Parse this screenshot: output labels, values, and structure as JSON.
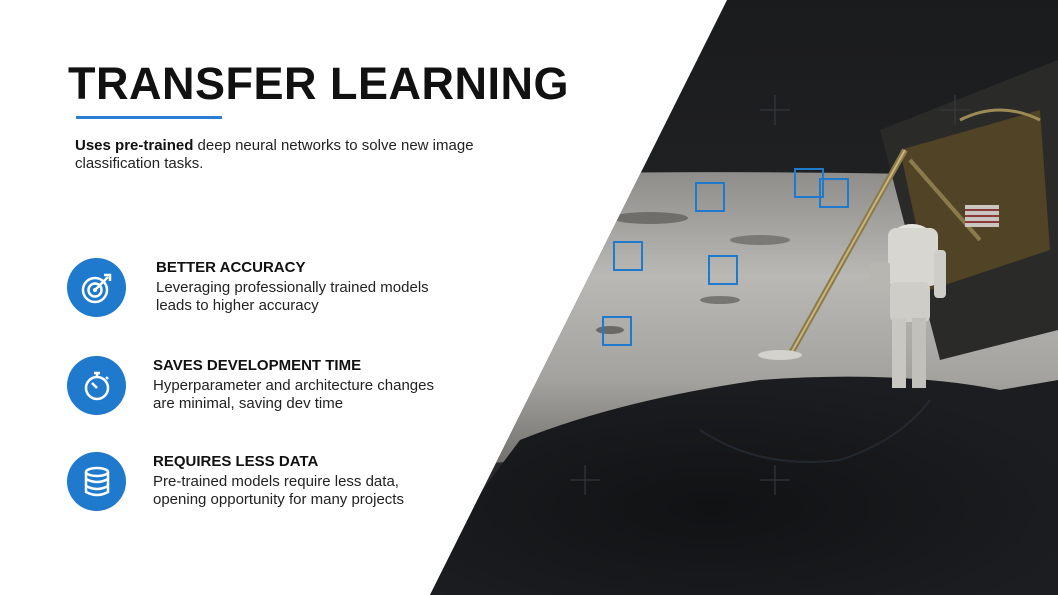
{
  "slide": {
    "title": "TRANSFER LEARNING",
    "accent_color": "#2a7fd4",
    "subtitle": {
      "bold": "Uses pre-trained",
      "rest": " deep neural networks to solve new image classification tasks."
    },
    "features": [
      {
        "icon": "target-icon",
        "heading": "BETTER ACCURACY",
        "line1": "Leveraging professionally trained models",
        "line2": "leads to higher accuracy"
      },
      {
        "icon": "stopwatch-icon",
        "heading": "SAVES DEVELOPMENT TIME",
        "line1": "Hyperparameter and architecture changes",
        "line2": "are minimal, saving dev time"
      },
      {
        "icon": "database-icon",
        "heading": "REQUIRES LESS DATA",
        "line1": "Pre-trained models require less data,",
        "line2": "opening opportunity for many projects"
      }
    ]
  }
}
